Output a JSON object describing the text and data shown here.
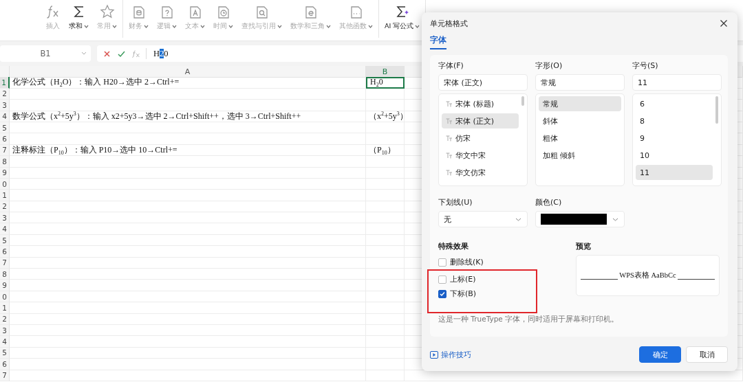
{
  "ribbon": {
    "groups": [
      [
        {
          "label": "插入",
          "has_menu": false,
          "disabled": true
        },
        {
          "label": "求和",
          "has_menu": true,
          "disabled": false
        },
        {
          "label": "常用",
          "has_menu": true,
          "disabled": true
        }
      ],
      [
        {
          "label": "财务",
          "has_menu": true,
          "disabled": true
        },
        {
          "label": "逻辑",
          "has_menu": true,
          "disabled": true
        },
        {
          "label": "文本",
          "has_menu": true,
          "disabled": true
        },
        {
          "label": "时间",
          "has_menu": true,
          "disabled": true
        },
        {
          "label": "查找与引用",
          "has_menu": true,
          "disabled": true
        },
        {
          "label": "数学和三角",
          "has_menu": true,
          "disabled": true
        },
        {
          "label": "其他函数",
          "has_menu": true,
          "disabled": true
        }
      ],
      [
        {
          "label": "AI 写公式",
          "has_menu": true,
          "disabled": false
        }
      ]
    ]
  },
  "formula_bar": {
    "name_box": "B1",
    "content_before": "H",
    "content_selected": "2",
    "content_after": "0"
  },
  "sheet": {
    "columns": [
      {
        "label": "A",
        "selected": false
      },
      {
        "label": "B",
        "selected": true
      }
    ],
    "rows": [
      {
        "number": "1",
        "selected": true,
        "cells": [
          {
            "text": "化学公式（H$_{2}$O）：输入 H20→选中 2→Ctrl+=",
            "selected": false
          },
          {
            "text": "H$_{2}$0",
            "selected": true
          }
        ]
      },
      {
        "number": "2",
        "selected": false
      },
      {
        "number": "3",
        "selected": false
      },
      {
        "number": "4",
        "selected": false,
        "cells": [
          {
            "text": "数学公式（x$^{2}$+5y$^{3}$）：输入 x2+5y3→选中 2→Ctrl+Shift++，选中 3→Ctrl+Shift++",
            "selected": false
          },
          {
            "text": "（x$^{2}$+5y$^{3}$）",
            "selected": false
          }
        ]
      },
      {
        "number": "5",
        "selected": false
      },
      {
        "number": "6",
        "selected": false
      },
      {
        "number": "7",
        "selected": false,
        "cells": [
          {
            "text": "注释标注（P$_{10}$）：输入 P10→选中 10→Ctrl+=",
            "selected": false
          },
          {
            "text": "（P$_{10}$）",
            "selected": false
          }
        ]
      },
      {
        "number": "8",
        "selected": false
      },
      {
        "number": "9",
        "selected": false
      },
      {
        "number": "0",
        "selected": false
      },
      {
        "number": "1",
        "selected": false
      },
      {
        "number": "2",
        "selected": false
      },
      {
        "number": "3",
        "selected": false
      },
      {
        "number": "4",
        "selected": false
      },
      {
        "number": "5",
        "selected": false
      },
      {
        "number": "6",
        "selected": false
      },
      {
        "number": "7",
        "selected": false
      },
      {
        "number": "8",
        "selected": false
      },
      {
        "number": "9",
        "selected": false
      },
      {
        "number": "0",
        "selected": false
      },
      {
        "number": "1",
        "selected": false
      },
      {
        "number": "2",
        "selected": false
      },
      {
        "number": "3",
        "selected": false
      },
      {
        "number": "4",
        "selected": false
      },
      {
        "number": "5",
        "selected": false
      },
      {
        "number": "6",
        "selected": false
      },
      {
        "number": "7",
        "selected": false
      }
    ]
  },
  "dialog": {
    "title": "单元格格式",
    "tabs": [
      {
        "label": "字体",
        "selected": true
      }
    ],
    "lists": [
      {
        "label": "字体(F)",
        "value": "宋体 (正文)",
        "kind": "font",
        "options": [
          {
            "label": "宋体 (标题)",
            "selected": false
          },
          {
            "label": "宋体 (正文)",
            "selected": true
          },
          {
            "label": "仿宋",
            "selected": false
          },
          {
            "label": "华文中宋",
            "selected": false
          },
          {
            "label": "华文仿宋",
            "selected": false
          }
        ]
      },
      {
        "label": "字形(O)",
        "value": "常规",
        "kind": "plain",
        "options": [
          {
            "label": "常规",
            "selected": true
          },
          {
            "label": "斜体",
            "selected": false
          },
          {
            "label": "粗体",
            "selected": false
          },
          {
            "label": "加粗 倾斜",
            "selected": false
          }
        ]
      },
      {
        "label": "字号(S)",
        "value": "11",
        "kind": "scroll",
        "options": [
          {
            "label": "6",
            "selected": false
          },
          {
            "label": "8",
            "selected": false
          },
          {
            "label": "9",
            "selected": false
          },
          {
            "label": "10",
            "selected": false
          },
          {
            "label": "11",
            "selected": true
          }
        ]
      }
    ],
    "underline": {
      "label": "下划线(U)",
      "value": "无"
    },
    "color": {
      "label": "颜色(C)",
      "color": "#000000"
    },
    "effects": {
      "title": "特殊效果",
      "items": [
        {
          "label": "删除线(K)",
          "checked": false,
          "highlighted": false
        },
        {
          "label": "上标(E)",
          "checked": false,
          "highlighted": true
        },
        {
          "label": "下标(B)",
          "checked": true,
          "highlighted": true
        }
      ]
    },
    "preview": {
      "title": "预览",
      "sample": "WPS表格  AaBbCc"
    },
    "note": "这是一种 TrueType 字体，同时适用于屏幕和打印机。",
    "tips_link": "操作技巧",
    "buttons": [
      {
        "label": "确定",
        "kind": "primary"
      },
      {
        "label": "取消",
        "kind": "secondary"
      }
    ]
  }
}
